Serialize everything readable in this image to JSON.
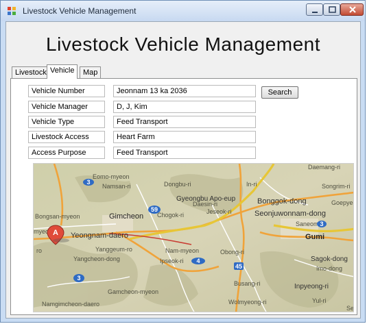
{
  "window": {
    "title": "Livestock Vehicle Management"
  },
  "heading": "Livestock Vehicle Management",
  "tabs": [
    {
      "label": "Livestock"
    },
    {
      "label": "Vehicle",
      "selected": true
    },
    {
      "label": "Map"
    }
  ],
  "form": {
    "fields": [
      {
        "label": "Vehicle Number",
        "value": "Jeonnam 13 ka 2036"
      },
      {
        "label": "Vehicle Manager",
        "value": "D, J, Kim"
      },
      {
        "label": "Vehicle Type",
        "value": "Feed Transport"
      },
      {
        "label": "Livestock Access",
        "value": "Heart Farm"
      },
      {
        "label": "Access Purpose",
        "value": "Feed Transport"
      }
    ],
    "search_label": "Search"
  },
  "map": {
    "marker_label": "A",
    "places": [
      "Daemang-ri",
      "Eomo-myeon",
      "Namsan-ri",
      "Dongbu-ri",
      "In-ri",
      "Songrim-ri",
      "Gyeongbu Apo-eup",
      "Daesin-ri",
      "Bonggok-dong",
      "Goepyeong",
      "Bongsan-myeon",
      "Gimcheon",
      "Chogok-ri",
      "Jeseok-ri",
      "Seonjuwonnam-dong",
      "Saneom-ro",
      "Gumi",
      "Yeongnam-daero",
      "Yanggeum-ro",
      "Nam-myeon",
      "Obong-ri",
      "Sagok-dong",
      "Imo-dong",
      "Yangcheon-dong",
      "Ipseok-ri",
      "Busang-ri",
      "Inpyeong-ri",
      "Gamcheon-myeon",
      "Wolmyeong-ri",
      "Yul-ri",
      "Namgimcheon-daero",
      "Se",
      "ro",
      "myeon"
    ],
    "shields": [
      "3",
      "59",
      "3",
      "4",
      "45",
      "3"
    ],
    "colors": {
      "terrain": "#d4d1b2",
      "road_major": "#f0a33a",
      "road_minor": "#ffffff",
      "highway": "#ffe36a",
      "marker": "#e04b3a"
    }
  }
}
